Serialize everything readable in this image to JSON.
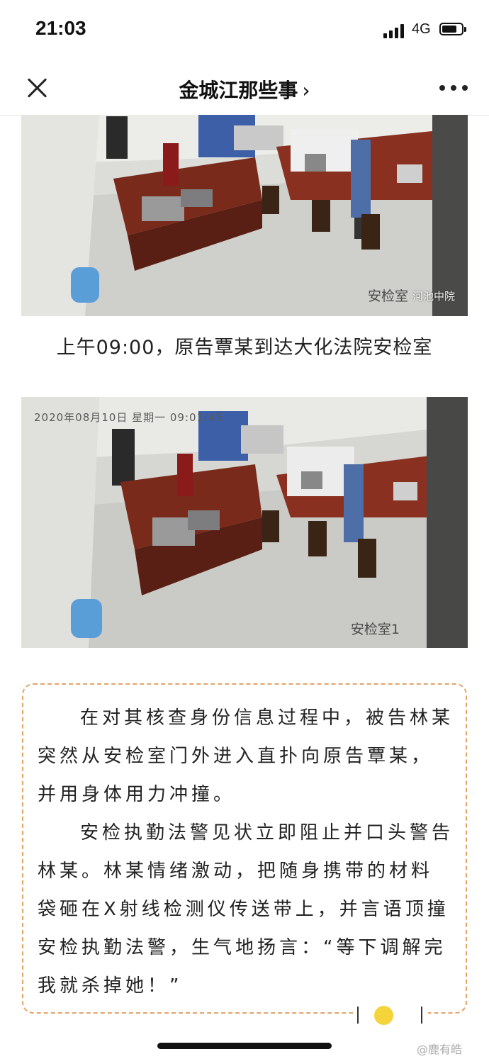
{
  "status_bar": {
    "time": "21:03",
    "network": "4G"
  },
  "nav": {
    "title": "金城江那些事",
    "title_chevron": "›",
    "close_icon": "close-icon",
    "more_icon": "more-icon"
  },
  "photos": [
    {
      "label_room": "安检室",
      "label_court": "河池中院"
    },
    {
      "label_timestamp": "2020年08月10日 星期一 09:01:45",
      "label_room": "安检室1"
    }
  ],
  "caption": "上午09:00，原告覃某到达大化法院安检室",
  "quote": {
    "paragraphs": [
      "在对其核查身份信息过程中，被告林某突然从安检室门外进入直扑向原告覃某，并用身体用力冲撞。",
      "安检执勤法警见状立即阻止并口头警告林某。林某情绪激动，把随身携带的材料袋砸在X射线检测仪传送带上，并言语顶撞安检执勤法警，生气地扬言：“等下调解完我就杀掉她！”"
    ],
    "accent_color": "#e3a46a",
    "dot_color": "#f5d33a"
  },
  "weibo_watermark": "@鹿有皓"
}
